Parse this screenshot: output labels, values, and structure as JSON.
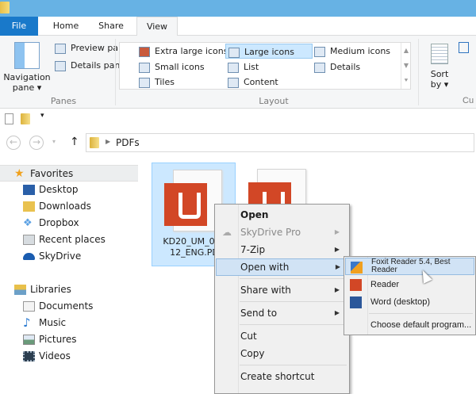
{
  "ribbon": {
    "tabs": [
      "File",
      "Home",
      "Share",
      "View"
    ],
    "panes": {
      "navigation_pane": "Navigation",
      "navigation_pane2": "pane",
      "preview_pane": "Preview pane",
      "details_pane": "Details pane",
      "label": "Panes"
    },
    "layout": {
      "items": [
        "Extra large icons",
        "Large icons",
        "Medium icons",
        "Small icons",
        "List",
        "Details",
        "Tiles",
        "Content"
      ],
      "selected": "Large icons",
      "label": "Layout"
    },
    "sort": {
      "label1": "Sort",
      "label2": "by"
    },
    "current_view_label": "Cu"
  },
  "address": {
    "path": "PDFs"
  },
  "nav": {
    "favorites": "Favorites",
    "favorite_items": [
      "Desktop",
      "Downloads",
      "Dropbox",
      "Recent places",
      "SkyDrive"
    ],
    "libraries": "Libraries",
    "library_items": [
      "Documents",
      "Music",
      "Pictures",
      "Videos"
    ]
  },
  "files": [
    {
      "line1": "KD20_UM_072",
      "line2": "12_ENG.PD"
    },
    {
      "line1": "",
      "line2": ""
    }
  ],
  "context_menu": {
    "open": "Open",
    "skydrive": "SkyDrive Pro",
    "zip": "7-Zip",
    "open_with": "Open with",
    "share_with": "Share with",
    "send_to": "Send to",
    "cut": "Cut",
    "copy": "Copy",
    "create_shortcut": "Create shortcut",
    "submenu_arrow": "▶"
  },
  "open_with_menu": {
    "items": [
      "Foxit Reader 5.4, Best Reader",
      "Reader",
      "Word (desktop)"
    ],
    "choose": "Choose default program..."
  },
  "colors": {
    "accent": "#1979ca",
    "titlebar": "#67b2e4",
    "pdf": "#d24726",
    "selection": "#cce8ff"
  }
}
